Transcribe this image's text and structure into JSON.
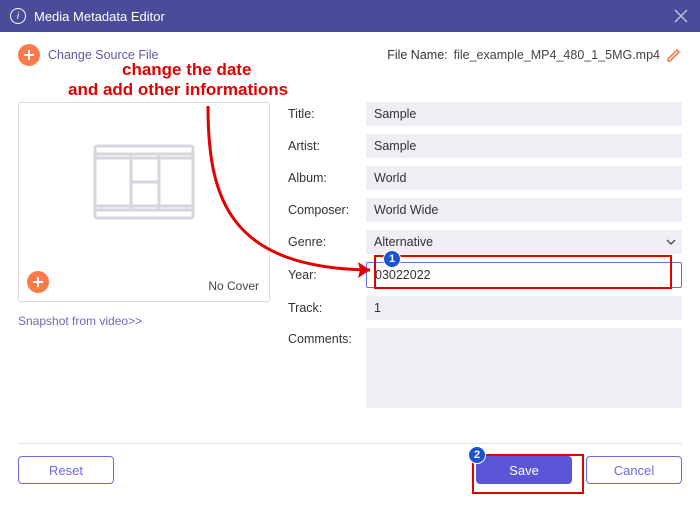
{
  "window": {
    "title": "Media Metadata Editor"
  },
  "topbar": {
    "change_source_label": "Change Source File",
    "file_name_label": "File Name:",
    "file_name_value": "file_example_MP4_480_1_5MG.mp4"
  },
  "cover": {
    "no_cover_label": "No Cover",
    "snapshot_link": "Snapshot from video>>"
  },
  "fields": {
    "title": {
      "label": "Title:",
      "value": "Sample"
    },
    "artist": {
      "label": "Artist:",
      "value": "Sample"
    },
    "album": {
      "label": "Album:",
      "value": "World"
    },
    "composer": {
      "label": "Composer:",
      "value": "World Wide"
    },
    "genre": {
      "label": "Genre:",
      "value": "Alternative"
    },
    "year": {
      "label": "Year:",
      "value": "03022022"
    },
    "track": {
      "label": "Track:",
      "value": "1"
    },
    "comments": {
      "label": "Comments:",
      "value": ""
    }
  },
  "footer": {
    "reset": "Reset",
    "save": "Save",
    "cancel": "Cancel"
  },
  "annotations": {
    "headline_line1": "change the date",
    "headline_line2": "and add other informations",
    "badge1": "1",
    "badge2": "2"
  }
}
